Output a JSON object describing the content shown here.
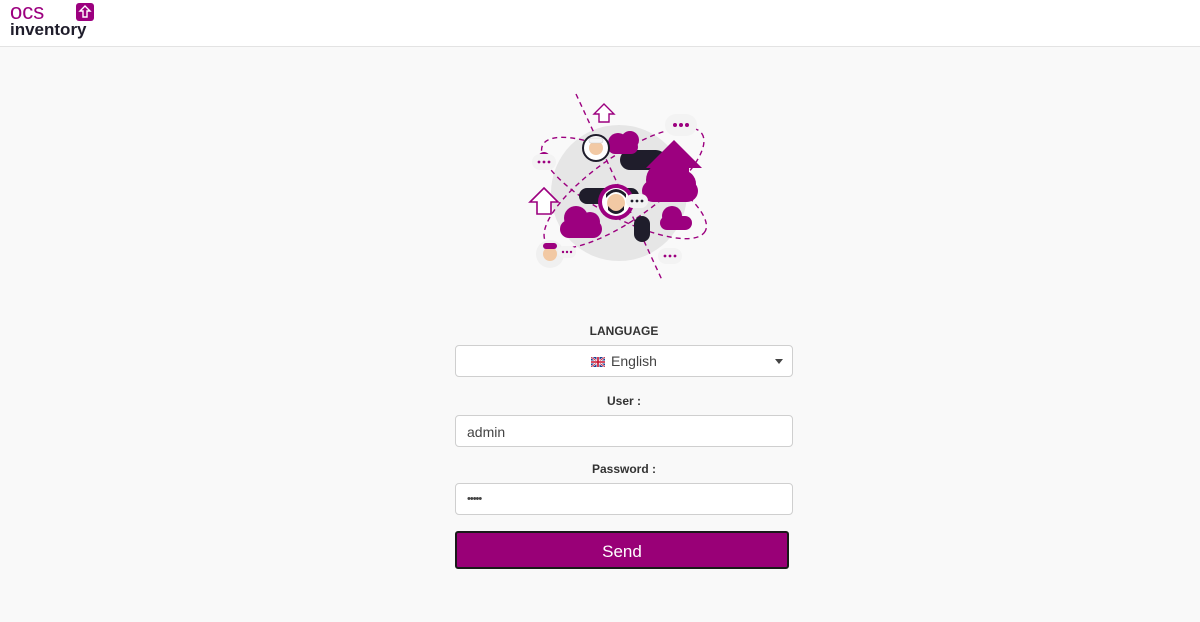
{
  "header": {
    "logo_top": "ocs",
    "logo_bottom": "inventory"
  },
  "form": {
    "language_label": "LANGUAGE",
    "language_value": "English",
    "user_label": "User :",
    "user_value": "admin",
    "password_label": "Password :",
    "password_value": "•••••",
    "send_label": "Send"
  },
  "colors": {
    "accent": "#990077",
    "dark": "#1f1d2b"
  }
}
